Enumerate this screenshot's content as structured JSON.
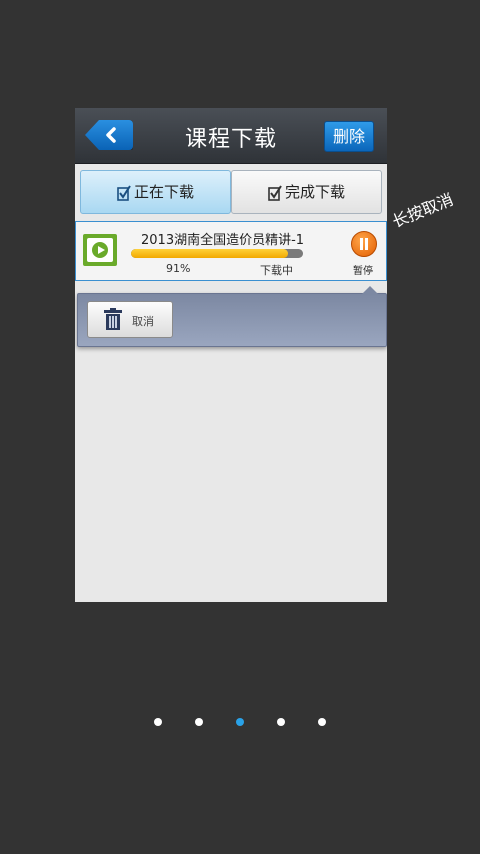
{
  "header": {
    "title": "课程下载",
    "delete_label": "删除"
  },
  "tabs": [
    {
      "label": "正在下载",
      "active": true
    },
    {
      "label": "完成下载",
      "active": false
    }
  ],
  "download": {
    "title": "2013湖南全国造价员精讲-1",
    "progress_percent": 91,
    "percent_text": "91%",
    "status": "下载中",
    "pause_label": "暂停"
  },
  "action_panel": {
    "cancel_label": "取消"
  },
  "hint": "长按取消",
  "pager": {
    "count": 5,
    "active_index": 2
  },
  "colors": {
    "accent": "#2aa2e8",
    "progress": "#ffc000",
    "header_bg": "#3b3f45"
  }
}
